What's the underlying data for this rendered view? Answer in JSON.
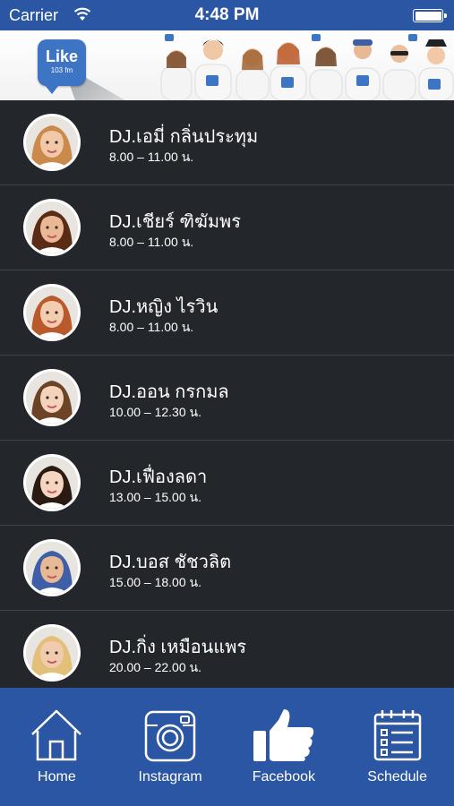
{
  "status_bar": {
    "carrier": "Carrier",
    "time": "4:48 PM"
  },
  "banner": {
    "logo_text": "Like",
    "logo_sub": "103 fm"
  },
  "dj_list": [
    {
      "name": "DJ.เอมี่ กลิ่นประทุม",
      "hours": "8.00 – 11.00 น.",
      "skin": "#f1c9a8",
      "hair": "#c98a4b"
    },
    {
      "name": "DJ.เชียร์ ฑิฆัมพร",
      "hours": "8.00 – 11.00 น.",
      "skin": "#e9b997",
      "hair": "#5a2c16"
    },
    {
      "name": "DJ.หญิง ไรวิน",
      "hours": "8.00 – 11.00 น.",
      "skin": "#f3cdb0",
      "hair": "#b85a2c"
    },
    {
      "name": "DJ.ออน กรกมล",
      "hours": "10.00 – 12.30 น.",
      "skin": "#f4d2bc",
      "hair": "#6b4326"
    },
    {
      "name": "DJ.เฟื่องลดา",
      "hours": "13.00 – 15.00 น.",
      "skin": "#f5d4c1",
      "hair": "#2a1a12"
    },
    {
      "name": "DJ.บอส ชัชวลิต",
      "hours": "15.00 – 18.00 น.",
      "skin": "#e7b995",
      "hair": "#3e5fa8"
    },
    {
      "name": "DJ.กิ่ง เหมือนแพร",
      "hours": "20.00 – 22.00 น.",
      "skin": "#f1cbae",
      "hair": "#e2c07a"
    }
  ],
  "tab_bar": {
    "home": "Home",
    "instagram": "Instagram",
    "facebook": "Facebook",
    "schedule": "Schedule"
  },
  "colors": {
    "bar_blue": "#2b56a3",
    "list_background": "#23262b",
    "divider": "#3f444b"
  }
}
